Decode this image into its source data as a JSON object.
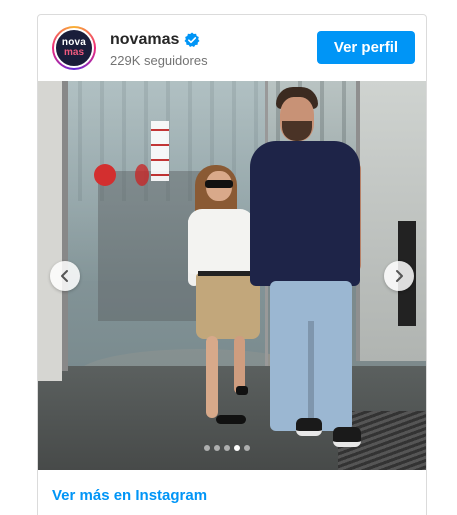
{
  "post": {
    "username": "novamas",
    "followers": "229K seguidores",
    "avatar_text_top": "nova",
    "avatar_text_bottom": "mas",
    "follow_button": "Ver perfil",
    "footer_link": "Ver más en Instagram",
    "carousel": {
      "total_slides": 5,
      "active_slide": 4
    }
  },
  "colors": {
    "accent": "#0095f6",
    "text_primary": "#262626",
    "text_secondary": "#737373"
  },
  "icons": [
    "verified-badge-icon",
    "chevron-left-icon",
    "chevron-right-icon"
  ]
}
